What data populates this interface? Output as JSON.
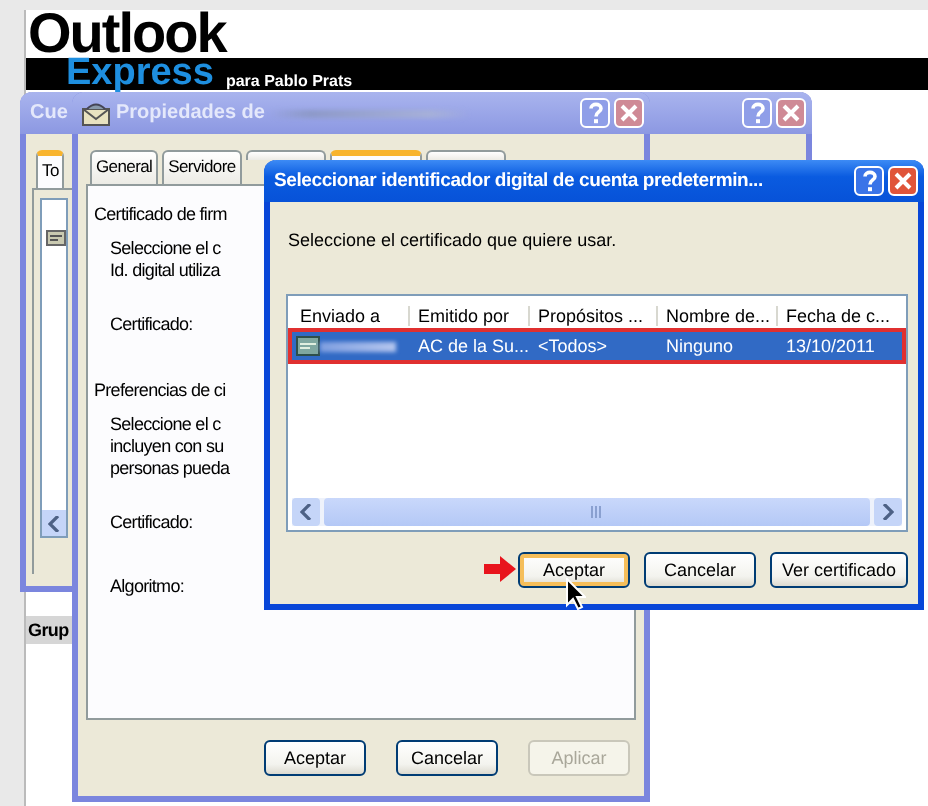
{
  "banner": {
    "logo_top": "Outlook",
    "logo_bottom": "Express",
    "subtitle": "para Pablo Prats",
    "panel_header": "Grup"
  },
  "accounts_window": {
    "title": "Cue",
    "active": false,
    "tabs": [
      {
        "label": "To",
        "selected": true
      }
    ]
  },
  "properties_window": {
    "title": "Propiedades de",
    "active": false,
    "tabs": [
      {
        "label": "General",
        "selected": false
      },
      {
        "label": "Servidore",
        "selected": false
      },
      {
        "selected": false
      },
      {
        "selected": true
      },
      {
        "selected": false
      }
    ],
    "lines": [
      {
        "kind": "heading",
        "text": "Certificado de firm"
      },
      {
        "kind": "text",
        "text": "Seleccione el c"
      },
      {
        "kind": "text",
        "text": "Id. digital utiliza"
      },
      {
        "kind": "label",
        "text": "Certificado:"
      },
      {
        "kind": "heading",
        "text": "Preferencias de ci"
      },
      {
        "kind": "text",
        "text": "Seleccione el c"
      },
      {
        "kind": "text",
        "text": "incluyen con su"
      },
      {
        "kind": "text",
        "text": "personas pueda"
      },
      {
        "kind": "label",
        "text": "Certificado:"
      },
      {
        "kind": "label",
        "text": "Algoritmo:"
      }
    ],
    "buttons": [
      {
        "label": "Aceptar",
        "disabled": false
      },
      {
        "label": "Cancelar",
        "disabled": false
      },
      {
        "label": "Aplicar",
        "disabled": true
      }
    ]
  },
  "certificate_dialog": {
    "title": "Seleccionar identificador digital de cuenta predetermin...",
    "active": true,
    "prompt": "Seleccione el certificado que quiere usar.",
    "columns": [
      "Enviado a",
      "Emitido por",
      "Propósitos ...",
      "Nombre de...",
      "Fecha de c..."
    ],
    "rows": [
      {
        "cells": [
          "",
          "AC de la Su...",
          "<Todos>",
          "Ninguno",
          "13/10/2011"
        ],
        "selected": true,
        "highlighted": true
      }
    ],
    "buttons": [
      {
        "label": "Aceptar",
        "focused": true,
        "pointed": true
      },
      {
        "label": "Cancelar",
        "focused": false,
        "pointed": false
      },
      {
        "label": "Ver certificado",
        "focused": false,
        "pointed": false
      }
    ]
  }
}
